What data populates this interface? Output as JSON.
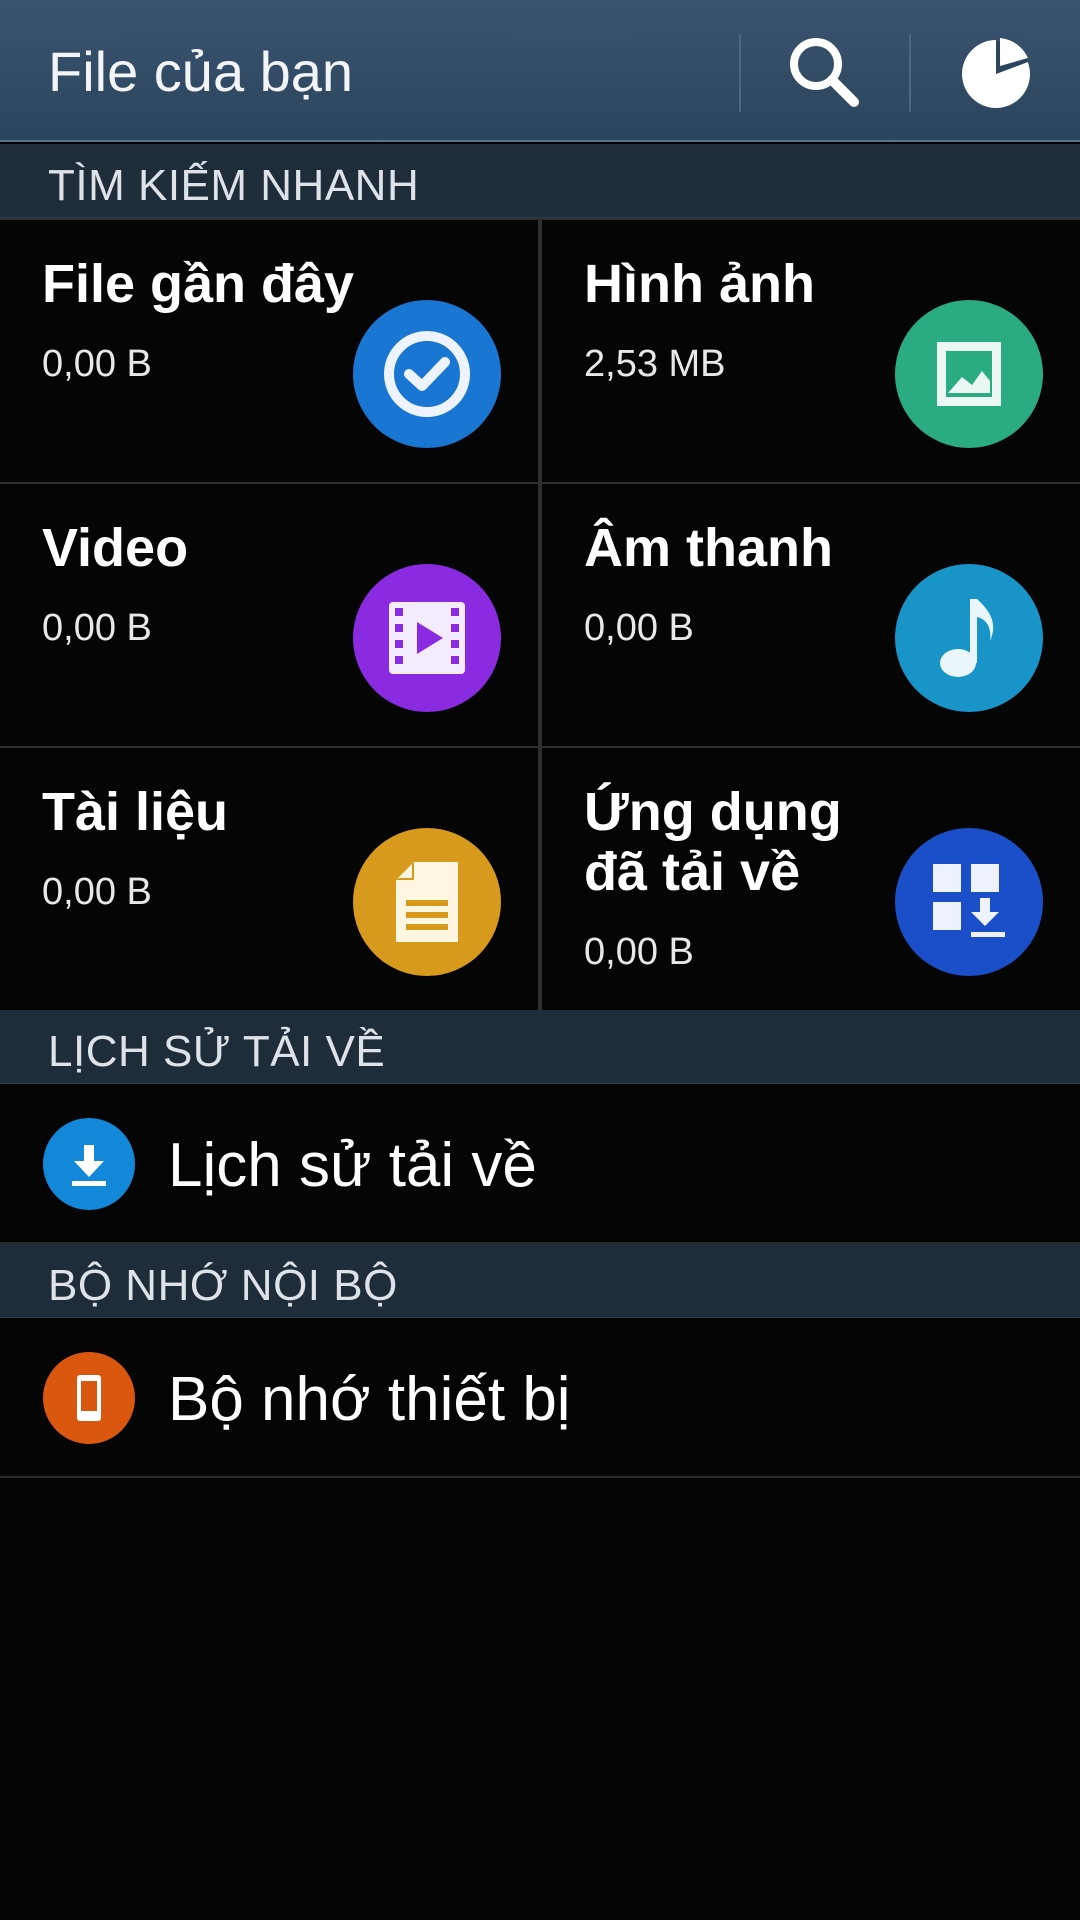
{
  "appbar": {
    "title": "File của bạn",
    "search_icon": "search-icon",
    "storage_icon": "storage-usage-icon"
  },
  "sections": {
    "quick_search": "TÌM KIẾM NHANH",
    "download_history": "LỊCH SỬ TẢI VỀ",
    "internal_storage": "BỘ NHỚ NỘI BỘ"
  },
  "tiles": [
    {
      "title": "File gần đây",
      "size": "0,00 B",
      "icon": "recent-files-icon",
      "color": "#1976d2"
    },
    {
      "title": "Hình ảnh",
      "size": "2,53 MB",
      "icon": "image-icon",
      "color": "#2bab82"
    },
    {
      "title": "Video",
      "size": "0,00 B",
      "icon": "video-icon",
      "color": "#8a2be2"
    },
    {
      "title": "Âm thanh",
      "size": "0,00 B",
      "icon": "music-note-icon",
      "color": "#1994c9"
    },
    {
      "title": "Tài liệu",
      "size": "0,00 B",
      "icon": "document-icon",
      "color": "#d89a1d"
    },
    {
      "title": "Ứng dụng đã tải về",
      "size": "0,00 B",
      "icon": "downloaded-apps-icon",
      "color": "#1a4fc9"
    }
  ],
  "download_history": {
    "label": "Lịch sử tải về",
    "icon": "download-icon",
    "color": "#1488d8"
  },
  "device_storage": {
    "label": "Bộ nhớ thiết bị",
    "icon": "phone-icon",
    "color": "#d9570f"
  }
}
